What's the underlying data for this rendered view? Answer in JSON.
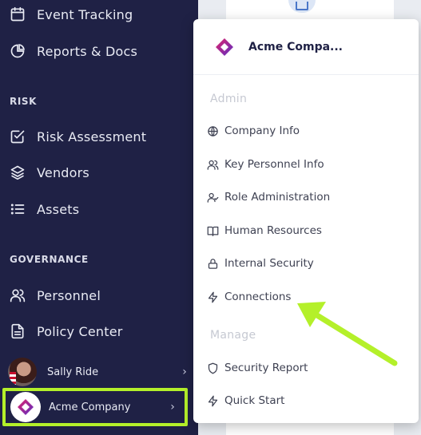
{
  "sidebar": {
    "items_top": [
      {
        "label": "Event Tracking",
        "icon": "calendar-icon"
      },
      {
        "label": "Reports & Docs",
        "icon": "pie-chart-icon"
      }
    ],
    "risk_heading": "RISK",
    "risk_items": [
      {
        "label": "Risk Assessment",
        "icon": "checkbox-icon"
      },
      {
        "label": "Vendors",
        "icon": "layers-icon"
      },
      {
        "label": "Assets",
        "icon": "list-icon"
      }
    ],
    "governance_heading": "GOVERNANCE",
    "governance_items": [
      {
        "label": "Personnel",
        "icon": "users-icon"
      },
      {
        "label": "Policy Center",
        "icon": "document-icon"
      }
    ],
    "user_name": "Sally Ride",
    "company_name": "Acme Company",
    "highlight_color": "#b4f02a",
    "bg_color": "#1f2145"
  },
  "menu": {
    "company_title": "Acme Compa...",
    "admin_heading": "Admin",
    "admin_items": [
      {
        "label": "Company Info",
        "icon": "globe-icon"
      },
      {
        "label": "Key Personnel Info",
        "icon": "users-icon"
      },
      {
        "label": "Role Administration",
        "icon": "user-check-icon"
      },
      {
        "label": "Human Resources",
        "icon": "book-icon"
      },
      {
        "label": "Internal Security",
        "icon": "lock-icon"
      },
      {
        "label": "Connections",
        "icon": "lightning-icon"
      }
    ],
    "manage_heading": "Manage",
    "manage_items": [
      {
        "label": "Security Report",
        "icon": "shield-icon"
      },
      {
        "label": "Quick Start",
        "icon": "lightning-icon"
      }
    ]
  },
  "annotation": {
    "arrow_color": "#b4f02a",
    "target": "Connections"
  }
}
